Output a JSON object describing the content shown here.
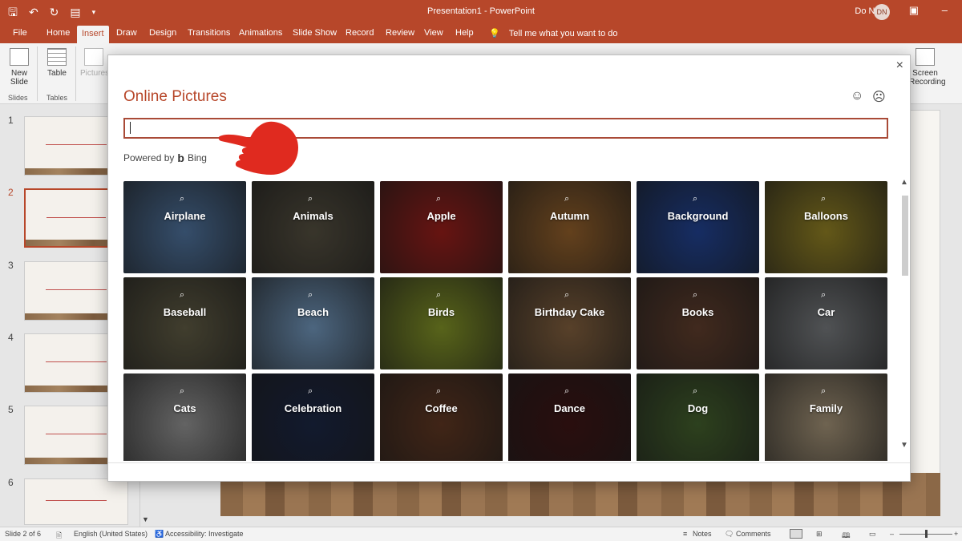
{
  "window": {
    "title": "Presentation1 - PowerPoint",
    "user_name": "Do Nhi",
    "user_initials": "DN"
  },
  "tabs": [
    "File",
    "Home",
    "Insert",
    "Draw",
    "Design",
    "Transitions",
    "Animations",
    "Slide Show",
    "Record",
    "Review",
    "View",
    "Help"
  ],
  "active_tab": "Insert",
  "tell_me": "Tell me what you want to do",
  "ribbon": {
    "new_slide": "New Slide",
    "table": "Table",
    "pictures": "Pictures",
    "screen_recording": "Screen Recording",
    "group_slides": "Slides",
    "group_tables": "Tables"
  },
  "thumbnails": [
    "1",
    "2",
    "3",
    "4",
    "5",
    "6"
  ],
  "active_slide": "2",
  "status": {
    "slide_info": "Slide 2 of 6",
    "language": "English (United States)",
    "accessibility": "Accessibility: Investigate",
    "notes": "Notes",
    "comments": "Comments"
  },
  "dialog": {
    "title": "Online Pictures",
    "search_value": "",
    "powered_by": "Powered by",
    "provider": "Bing",
    "close": "×",
    "tiles": [
      {
        "label": "Airplane",
        "color": "#4a6c94"
      },
      {
        "label": "Animals",
        "color": "#4f4a3c"
      },
      {
        "label": "Apple",
        "color": "#8f1d18"
      },
      {
        "label": "Autumn",
        "color": "#8a5a28"
      },
      {
        "label": "Background",
        "color": "#1f3f8a"
      },
      {
        "label": "Balloons",
        "color": "#8a7a22"
      },
      {
        "label": "Baseball",
        "color": "#5a5640"
      },
      {
        "label": "Beach",
        "color": "#6a8db0"
      },
      {
        "label": "Birds",
        "color": "#7a8a24"
      },
      {
        "label": "Birthday Cake",
        "color": "#7a5a3a"
      },
      {
        "label": "Books",
        "color": "#5a3a2a"
      },
      {
        "label": "Car",
        "color": "#6f7275"
      },
      {
        "label": "Cats",
        "color": "#8a8a8a"
      },
      {
        "label": "Celebration",
        "color": "#1a2440"
      },
      {
        "label": "Coffee",
        "color": "#5a3420"
      },
      {
        "label": "Dance",
        "color": "#3a1414"
      },
      {
        "label": "Dog",
        "color": "#3f5a2a"
      },
      {
        "label": "Family",
        "color": "#9a8a70"
      }
    ]
  }
}
